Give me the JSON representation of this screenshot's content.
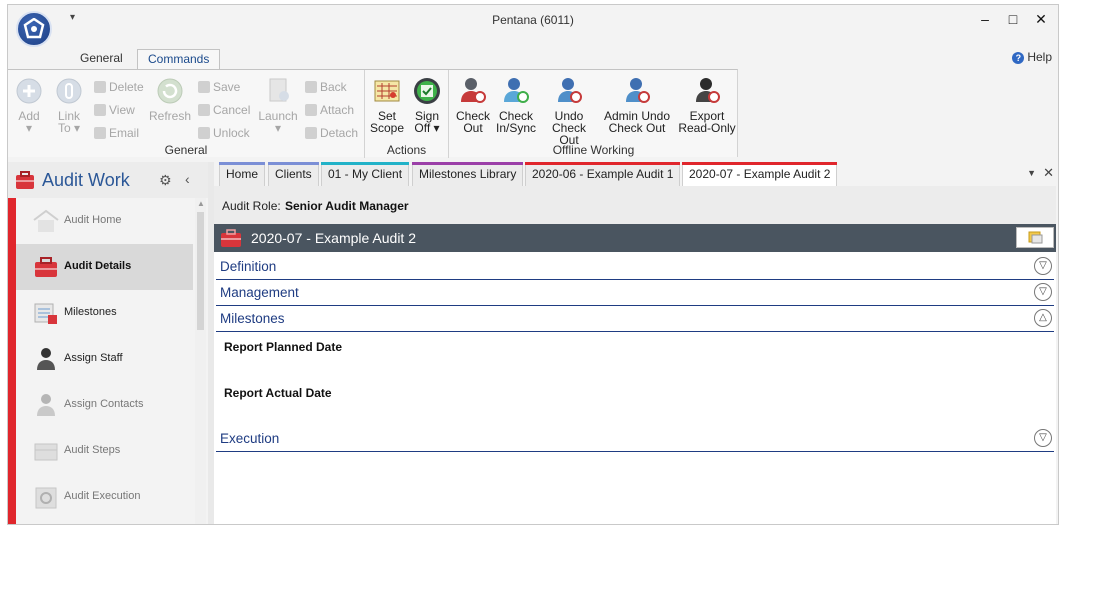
{
  "window": {
    "title": "Pentana (6011)",
    "qat_menu": "▾",
    "minimize": "–",
    "maximize": "□",
    "close": "✕"
  },
  "ribbon_tabs": [
    "General",
    "Commands"
  ],
  "help": "Help",
  "ribbon": {
    "general": {
      "label": "General",
      "add": "Add",
      "link": "Link",
      "link_to": "To ▾",
      "delete": "Delete",
      "view": "View",
      "email": "Email",
      "refresh": "Refresh",
      "save": "Save",
      "cancel": "Cancel",
      "unlock": "Unlock",
      "launch": "Launch",
      "back": "Back",
      "attach": "Attach",
      "detach": "Detach"
    },
    "actions": {
      "label": "Actions",
      "set_scope_1": "Set",
      "set_scope_2": "Scope",
      "sign_off_1": "Sign",
      "sign_off_2": "Off ▾"
    },
    "offline": {
      "label": "Offline Working",
      "check_out_1": "Check",
      "check_out_2": "Out",
      "check_in_1": "Check",
      "check_in_2": "In/Sync",
      "undo_1": "Undo",
      "undo_2": "Check Out",
      "admin_undo_1": "Admin Undo",
      "admin_undo_2": "Check Out",
      "export_1": "Export",
      "export_2": "Read-Only"
    }
  },
  "nav": {
    "title": "Audit Work",
    "gear": "⚙",
    "collapse": "‹",
    "items": [
      {
        "label": "Audit Home"
      },
      {
        "label": "Audit Details"
      },
      {
        "label": "Milestones"
      },
      {
        "label": "Assign Staff"
      },
      {
        "label": "Assign Contacts"
      },
      {
        "label": "Audit Steps"
      },
      {
        "label": "Audit Execution"
      }
    ]
  },
  "doc_tabs": [
    {
      "label": "Home",
      "color": "#7b8fd6"
    },
    {
      "label": "Clients",
      "color": "#7b8fd6"
    },
    {
      "label": "01 - My Client",
      "color": "#22b2c8"
    },
    {
      "label": "Milestones Library",
      "color": "#9b3fa8"
    },
    {
      "label": "2020-06 - Example Audit 1",
      "color": "#e0262c"
    },
    {
      "label": "2020-07 - Example Audit 2",
      "color": "#e0262c"
    }
  ],
  "content": {
    "role_label": "Audit Role:",
    "role_value": "Senior Audit Manager",
    "audit_title": "2020-07 - Example Audit 2",
    "sections": {
      "definition": "Definition",
      "management": "Management",
      "milestones": "Milestones",
      "execution": "Execution"
    },
    "fields": {
      "report_planned": "Report Planned Date",
      "report_actual": "Report Actual Date"
    }
  }
}
